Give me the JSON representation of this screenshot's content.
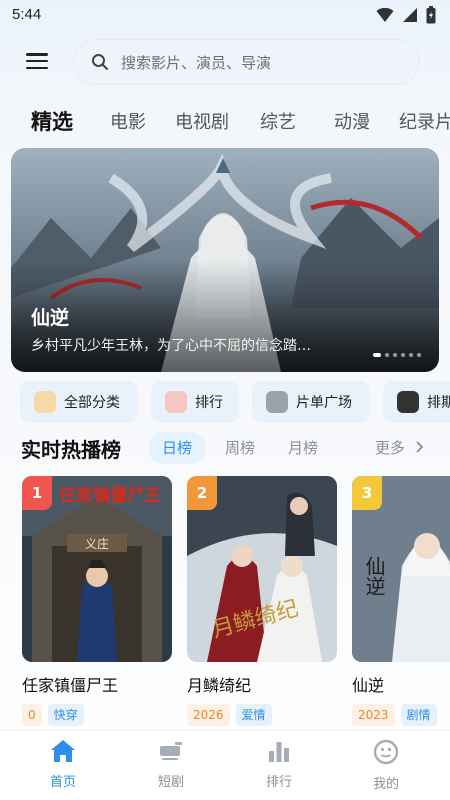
{
  "status": {
    "time": "5:44"
  },
  "search": {
    "placeholder": "搜索影片、演员、导演"
  },
  "tabs": [
    {
      "label": "精选",
      "active": true
    },
    {
      "label": "电影"
    },
    {
      "label": "电视剧"
    },
    {
      "label": "综艺"
    },
    {
      "label": "动漫"
    },
    {
      "label": "纪录片"
    }
  ],
  "banner": {
    "title": "仙逆",
    "description": "乡村平凡少年王林，为了心中不屈的信念踏…",
    "slide_count": 6,
    "active_slide": 1
  },
  "categories": [
    {
      "label": "全部分类",
      "icon": "dog-icon"
    },
    {
      "label": "排行",
      "icon": "pig-icon"
    },
    {
      "label": "片单广场",
      "icon": "cat-icon"
    },
    {
      "label": "排期",
      "icon": "panda-icon"
    }
  ],
  "ranking": {
    "title": "实时热播榜",
    "tabs": [
      "日榜",
      "周榜",
      "月榜"
    ],
    "active_tab": "日榜",
    "more": "更多",
    "items": [
      {
        "rank": "1",
        "name": "任家镇僵尸王",
        "poster_text": "任家镇僵尸王",
        "poster_sign": "义庄",
        "tags": [
          "0",
          "快穿"
        ]
      },
      {
        "rank": "2",
        "name": "月鳞绮纪",
        "poster_text": "月鳞绮纪",
        "tags": [
          "2026",
          "爱情"
        ]
      },
      {
        "rank": "3",
        "name": "仙逆",
        "poster_text": "仙逆",
        "tags": [
          "2023",
          "剧情"
        ]
      }
    ]
  },
  "colors": {
    "accent": "#2d8fe6",
    "rank1": "#f0554e",
    "rank2": "#f3983a",
    "rank3": "#f3c93a"
  },
  "bottom_nav": [
    {
      "label": "首页",
      "icon": "home-icon",
      "active": true
    },
    {
      "label": "短剧",
      "icon": "short-drama-icon"
    },
    {
      "label": "排行",
      "icon": "bar-chart-icon"
    },
    {
      "label": "我的",
      "icon": "profile-icon"
    }
  ]
}
